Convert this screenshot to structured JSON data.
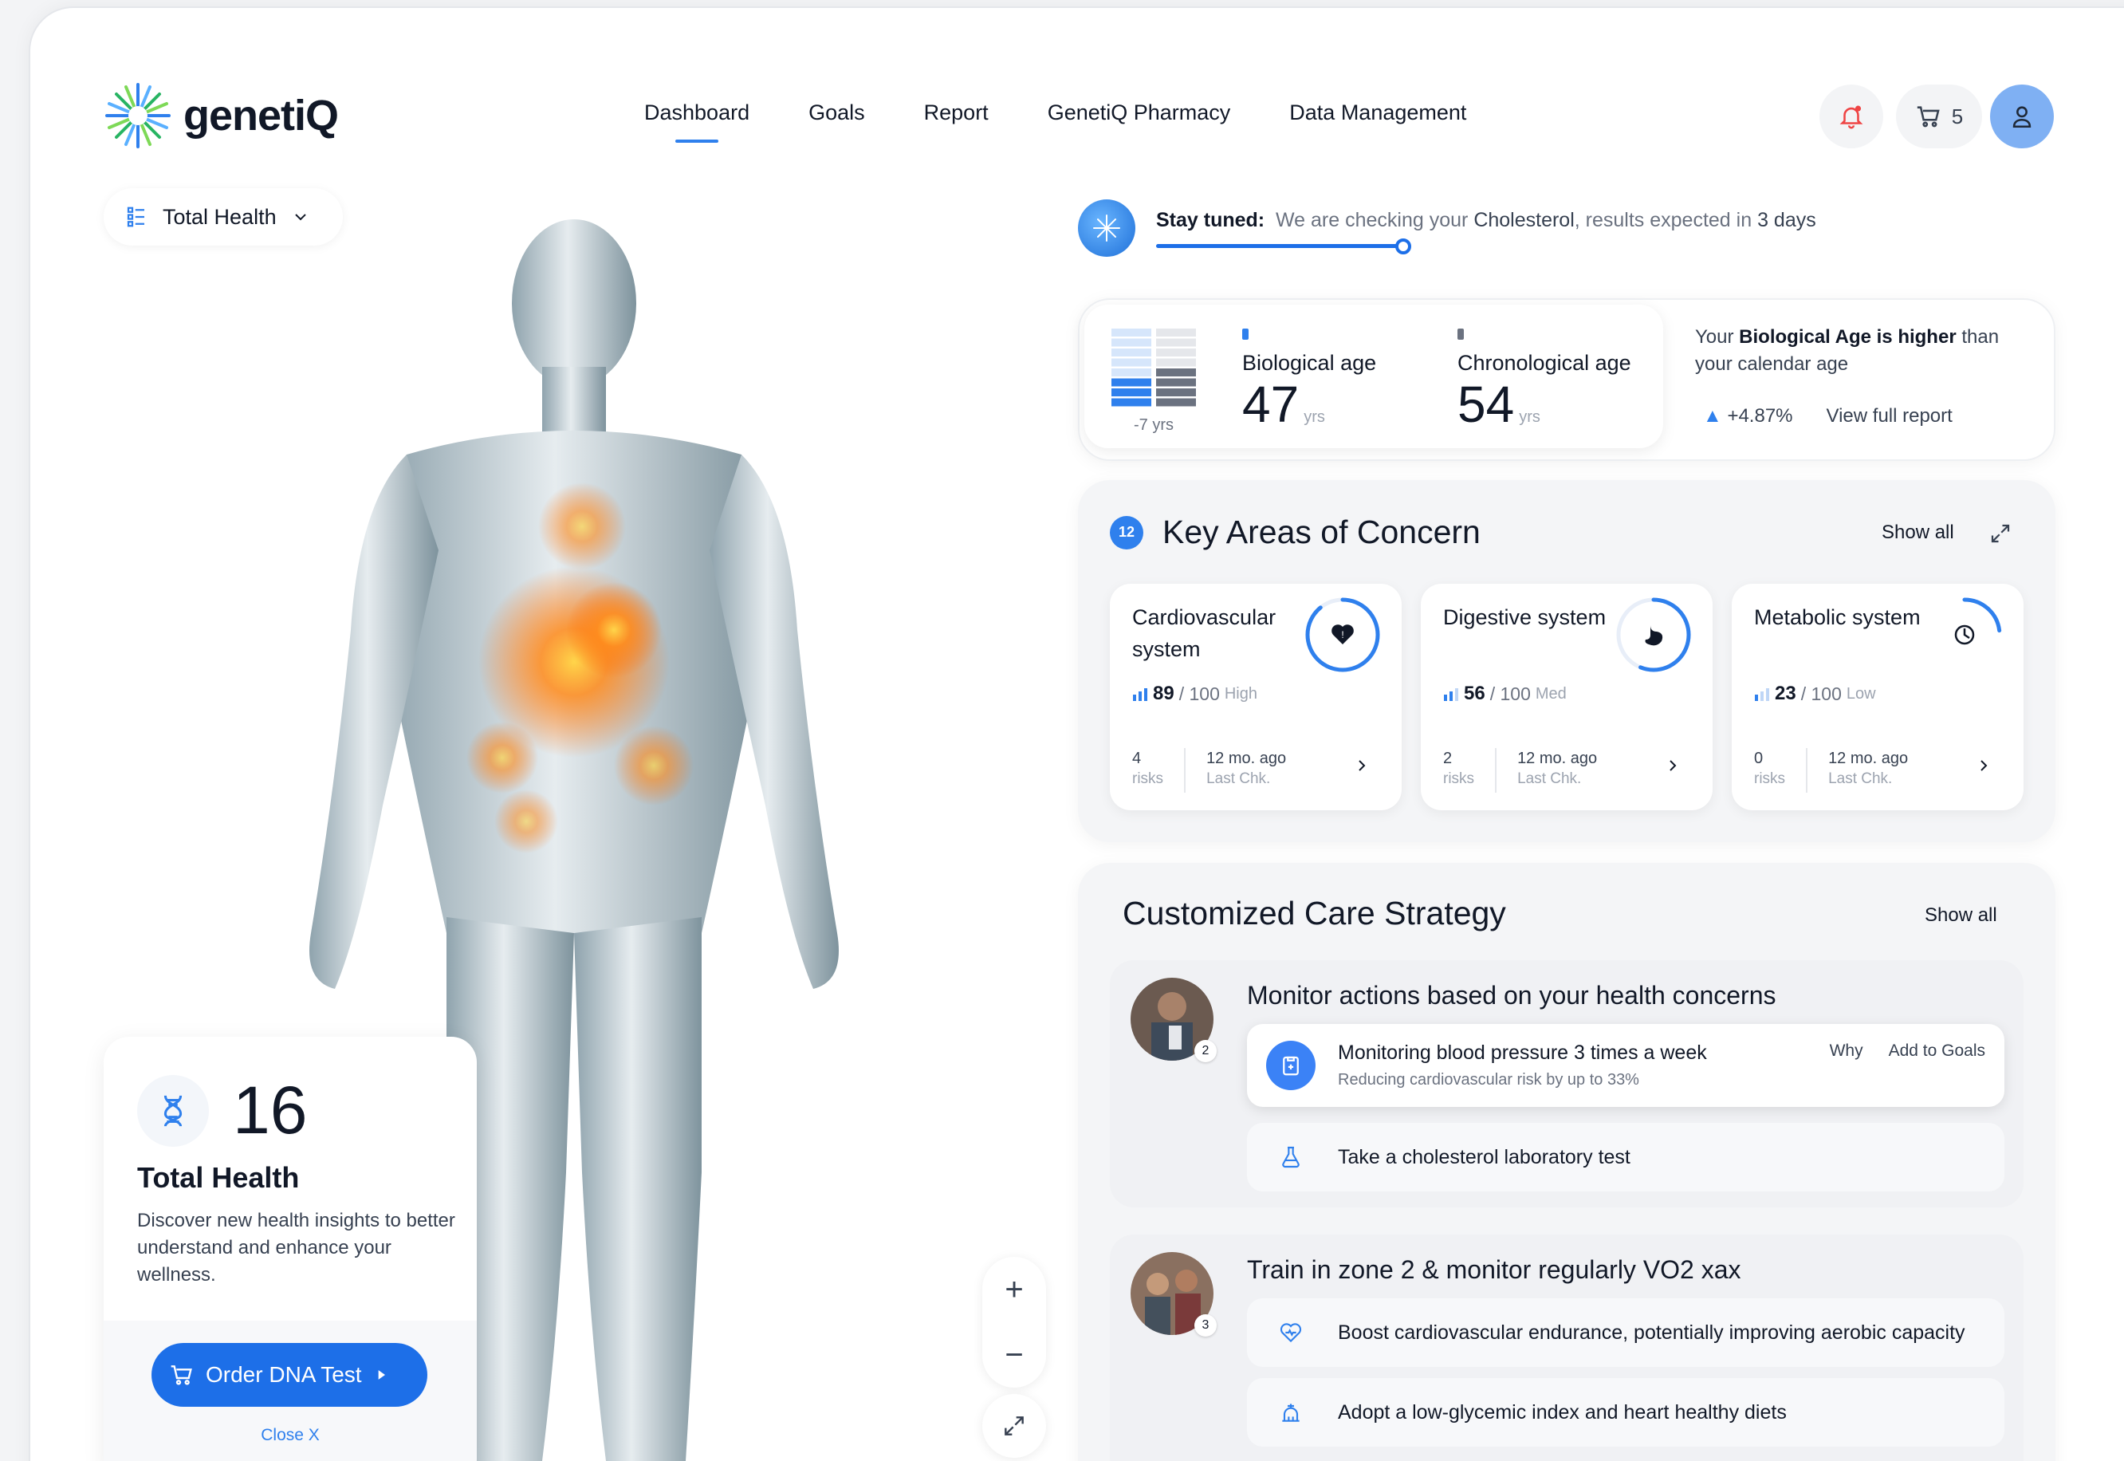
{
  "brand": {
    "name": "genetiQ"
  },
  "nav": {
    "items": [
      {
        "label": "Dashboard"
      },
      {
        "label": "Goals"
      },
      {
        "label": "Report"
      },
      {
        "label": "GenetiQ Pharmacy"
      },
      {
        "label": "Data Management"
      }
    ],
    "active": "Dashboard"
  },
  "header": {
    "cart_count": "5",
    "icons": [
      "bell-icon",
      "cart-icon",
      "user-icon"
    ]
  },
  "selector": {
    "label": "Total Health"
  },
  "info_card": {
    "number": "16",
    "title": "Total Health",
    "description": "Discover new health insights to better understand and enhance your wellness.",
    "cta": "Order DNA Test",
    "close": "Close X"
  },
  "zoom": {
    "plus": "+",
    "minus": "−"
  },
  "status": {
    "label": "Stay tuned:",
    "prefix": "We are checking your",
    "subject": "Cholesterol",
    "middle": ", results expected in",
    "eta": "3 days",
    "progress": 0.58
  },
  "ages": {
    "delta": "-7",
    "delta_unit": "yrs",
    "biological": {
      "label": "Biological age",
      "value": "47",
      "unit": "yrs"
    },
    "chronological": {
      "label": "Chronological age",
      "value": "54",
      "unit": "yrs"
    },
    "note_prefix": "Your",
    "note_bold": "Biological Age is higher",
    "note_suffix": "than your calendar age",
    "trend": "+4.87%",
    "report_link": "View full report"
  },
  "concerns": {
    "count": "12",
    "title": "Key Areas of Concern",
    "show_all": "Show all",
    "cards": [
      {
        "name": "Cardiovascular system",
        "score": "89",
        "max": "/ 100",
        "level": "High",
        "risks": "4",
        "risks_label": "risks",
        "last": "12 mo. ago",
        "last_label": "Last Chk.",
        "fraction": 0.89
      },
      {
        "name": "Digestive system",
        "score": "56",
        "max": "/ 100",
        "level": "Med",
        "risks": "2",
        "risks_label": "risks",
        "last": "12 mo. ago",
        "last_label": "Last Chk.",
        "fraction": 0.56
      },
      {
        "name": "Metabolic system",
        "score": "23",
        "max": "/ 100",
        "level": "Low",
        "risks": "0",
        "risks_label": "risks",
        "last": "12 mo. ago",
        "last_label": "Last Chk.",
        "fraction": 0.23
      }
    ]
  },
  "care": {
    "title": "Customized Care Strategy",
    "show_all": "Show all",
    "groups": [
      {
        "title": "Monitor actions based on your health concerns",
        "count": "2",
        "items": [
          {
            "text": "Monitoring blood pressure 3 times a week",
            "sub": "Reducing cardiovascular risk by up to 33%",
            "why": "Why",
            "add": "Add to Goals"
          },
          {
            "text": "Take a cholesterol laboratory test"
          }
        ]
      },
      {
        "title": "Train in zone 2 & monitor regularly VO2 xax",
        "count": "3",
        "items": [
          {
            "text": "Boost cardiovascular endurance, potentially improving aerobic capacity"
          },
          {
            "text": "Adopt a low-glycemic index and heart healthy diets"
          }
        ]
      }
    ]
  },
  "colors": {
    "accent": "#1d6fe8",
    "ring": "#2f80ed",
    "panel": "#f4f5f7"
  }
}
